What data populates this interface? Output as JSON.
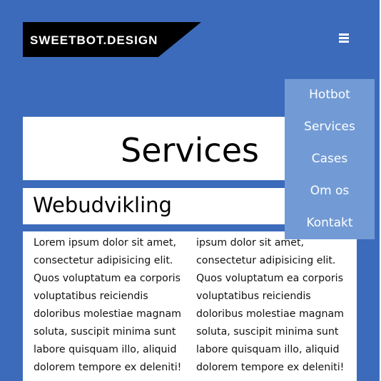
{
  "header": {
    "logo_text": "SWEETBOT.DESIGN",
    "menu_icon": "hamburger-icon"
  },
  "nav_menu": {
    "items": [
      {
        "label": "Hotbot"
      },
      {
        "label": "Services"
      },
      {
        "label": "Cases"
      },
      {
        "label": "Om os"
      },
      {
        "label": "Kontakt"
      }
    ]
  },
  "page": {
    "title": "Services",
    "section_title": "Webudvikling",
    "column_left": "Lorem ipsum dolor sit amet, consectetur adipisicing elit. Quos voluptatum ea corporis voluptatibus reiciendis doloribus molestiae magnam soluta, suscipit minima sunt labore quisquam illo, aliquid dolorem tempore ex deleniti!",
    "column_right": "ipsum dolor sit amet, consectetur adipisicing elit. Quos voluptatum ea corporis voluptatibus reiciendis doloribus molestiae magnam soluta, suscipit minima sunt labore quisquam illo, aliquid dolorem tempore ex deleniti!"
  },
  "colors": {
    "background": "#3c6bbb",
    "menu_background": "#729bd5",
    "logo_background": "#000000"
  }
}
